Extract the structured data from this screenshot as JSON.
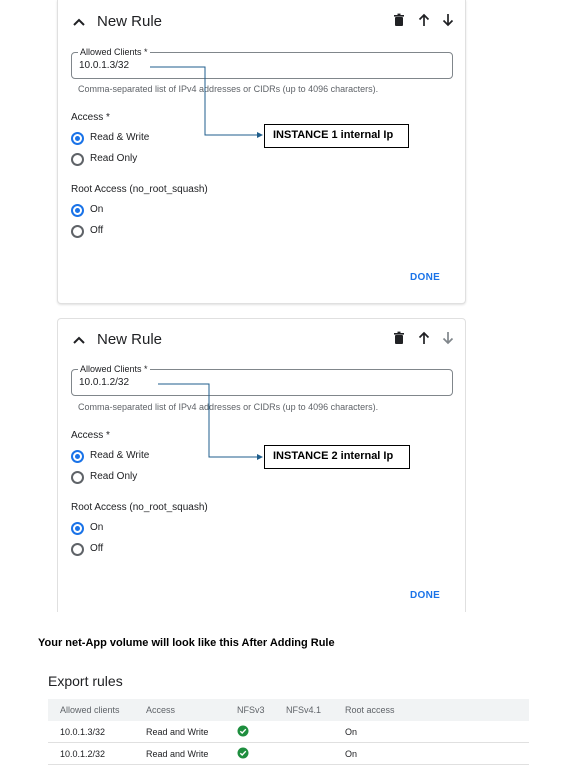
{
  "rules": [
    {
      "title": "New Rule",
      "icons": [
        "chevron-up-icon",
        "delete-icon",
        "arrow-up-icon",
        "arrow-down-icon"
      ],
      "allowed_clients_label": "Allowed Clients *",
      "allowed_clients_value": "10.0.1.3/32",
      "helper": "Comma-separated list of IPv4 addresses or CIDRs (up to 4096 characters).",
      "access_label": "Access *",
      "access_options": [
        "Read & Write",
        "Read Only"
      ],
      "access_selected": "Read & Write",
      "root_label": "Root Access (no_root_squash)",
      "root_options": [
        "On",
        "Off"
      ],
      "root_selected": "On",
      "done": "DONE",
      "callout": "INSTANCE 1 internal Ip"
    },
    {
      "title": "New Rule",
      "icons": [
        "chevron-up-icon",
        "delete-icon",
        "arrow-up-icon",
        "arrow-down-icon"
      ],
      "allowed_clients_label": "Allowed Clients *",
      "allowed_clients_value": "10.0.1.2/32",
      "helper": "Comma-separated list of IPv4 addresses or CIDRs (up to 4096 characters).",
      "access_label": "Access *",
      "access_options": [
        "Read & Write",
        "Read Only"
      ],
      "access_selected": "Read & Write",
      "root_label": "Root Access (no_root_squash)",
      "root_options": [
        "On",
        "Off"
      ],
      "root_selected": "On",
      "done": "DONE",
      "callout": "INSTANCE 2 internal Ip"
    }
  ],
  "caption": "Your net-App volume will look like this After Adding Rule",
  "export_rules": {
    "title": "Export rules",
    "columns": [
      "Allowed clients",
      "Access",
      "NFSv3",
      "NFSv4.1",
      "Root access"
    ],
    "rows": [
      {
        "allowed_clients": "10.0.1.3/32",
        "access": "Read and Write",
        "nfsv3": "check-circle-icon",
        "nfsv41": "",
        "root_access": "On"
      },
      {
        "allowed_clients": "10.0.1.2/32",
        "access": "Read and Write",
        "nfsv3": "check-circle-icon",
        "nfsv41": "",
        "root_access": "On"
      }
    ]
  },
  "colors": {
    "accent": "#1a73e8",
    "check": "#1e8e3e",
    "annotation_line": "#1f5e8c"
  }
}
